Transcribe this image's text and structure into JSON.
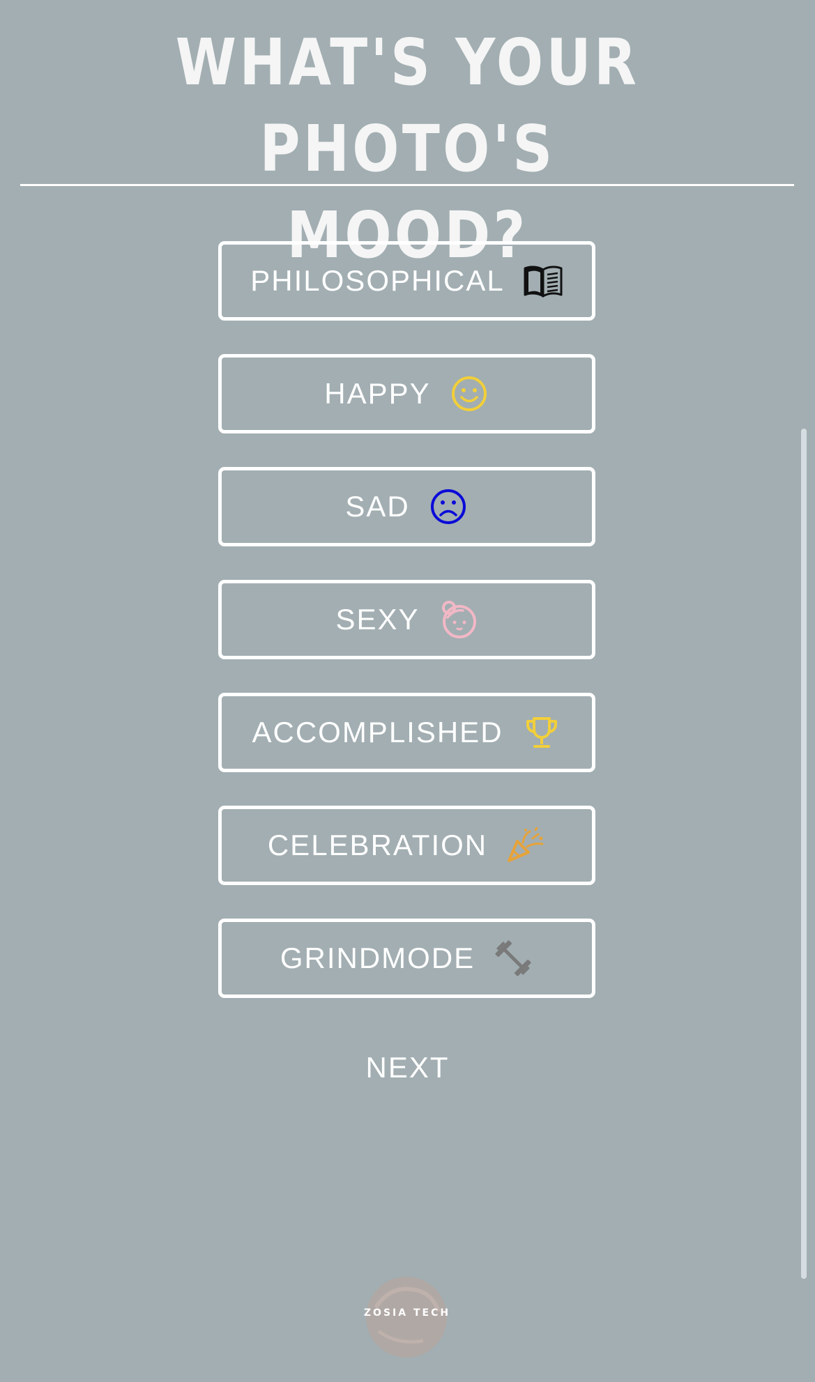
{
  "header": {
    "title_line1": "WHAT'S YOUR PHOTO'S",
    "title_line2": "MOOD?"
  },
  "moods": [
    {
      "label": "PHILOSOPHICAL",
      "icon": "open-book-icon",
      "color": "#111111"
    },
    {
      "label": "HAPPY",
      "icon": "smiley-face-icon",
      "color": "#f2cf3a"
    },
    {
      "label": "SAD",
      "icon": "sad-face-icon",
      "color": "#0a0ad8"
    },
    {
      "label": "SEXY",
      "icon": "girl-face-icon",
      "color": "#f2b8c6"
    },
    {
      "label": "ACCOMPLISHED",
      "icon": "trophy-icon",
      "color": "#f2cf3a"
    },
    {
      "label": "CELEBRATION",
      "icon": "party-popper-icon",
      "color": "#e7a33a"
    },
    {
      "label": "GRINDMODE",
      "icon": "dumbbell-icon",
      "color": "#7a7a7a"
    }
  ],
  "next_label": "NEXT",
  "footer": {
    "logo_text": "ZOSIA TECH"
  },
  "colors": {
    "background": "#a2aeb2",
    "foreground": "#ffffff"
  }
}
